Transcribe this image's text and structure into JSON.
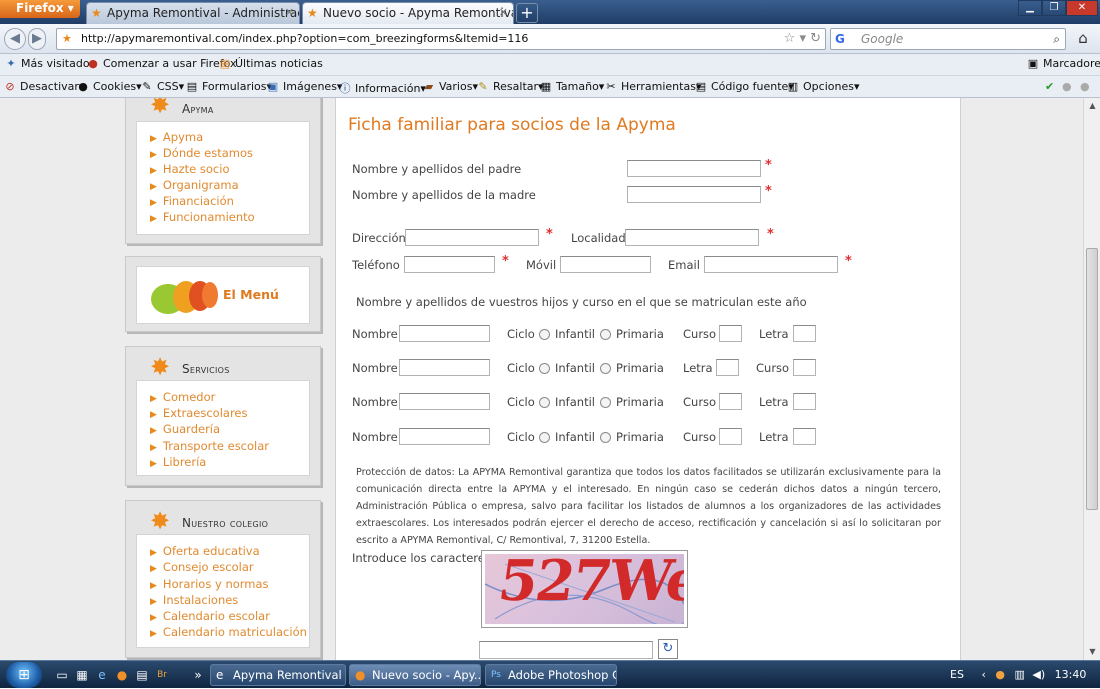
{
  "browser": {
    "menu_label": "Firefox",
    "tabs": [
      {
        "label": "Apyma Remontival - Administración",
        "active": false
      },
      {
        "label": "Nuevo socio - Apyma Remontival",
        "active": true
      }
    ],
    "url": "http://apymaremontival.com/index.php?option=com_breezingforms&Itemid=116",
    "search_placeholder": "Google",
    "bookmarks": [
      "Más visitados",
      "Comenzar a usar Firefox",
      "Últimas noticias"
    ],
    "bookmarks_right": "Marcadores",
    "webdev_menus": [
      "Desactivar",
      "Cookies",
      "CSS",
      "Formularios",
      "Imágenes",
      "Información",
      "Varios",
      "Resaltar",
      "Tamaño",
      "Herramientas",
      "Código fuente",
      "Opciones"
    ]
  },
  "sidebar": {
    "apyma": {
      "title": "Apyma",
      "items": [
        "Apyma",
        "Dónde estamos",
        "Hazte socio",
        "Organigrama",
        "Financiación",
        "Funcionamiento"
      ]
    },
    "menu_banner": "El Menú",
    "servicios": {
      "title": "Servicios",
      "items": [
        "Comedor",
        "Extraescolares",
        "Guardería",
        "Transporte escolar",
        "Librería"
      ]
    },
    "colegio": {
      "title": "Nuestro colegio",
      "items": [
        "Oferta educativa",
        "Consejo escolar",
        "Horarios y normas",
        "Instalaciones",
        "Calendario escolar",
        "Calendario matriculación"
      ]
    }
  },
  "form": {
    "title": "Ficha familiar para socios de la Apyma",
    "padre_label": "Nombre y apellidos del padre",
    "madre_label": "Nombre y apellidos de la madre",
    "direccion_label": "Dirección",
    "localidad_label": "Localidad",
    "telefono_label": "Teléfono",
    "movil_label": "Móvil",
    "email_label": "Email",
    "required_mark": "*",
    "children_heading": "Nombre y apellidos de vuestros hijos y curso en el que se matriculan este año",
    "children": [
      {
        "nombre": "Nombre",
        "ciclo": "Ciclo",
        "opt1": "Infantil",
        "opt2": "Primaria",
        "f1": "Curso",
        "f2": "Letra"
      },
      {
        "nombre": "Nombre",
        "ciclo": "Ciclo",
        "opt1": "Infantil",
        "opt2": "Primaria",
        "f1": "Letra",
        "f2": "Curso"
      },
      {
        "nombre": "Nombre",
        "ciclo": "Ciclo",
        "opt1": "Infantil",
        "opt2": "Primaria",
        "f1": "Curso",
        "f2": "Letra"
      },
      {
        "nombre": "Nombre",
        "ciclo": "Ciclo",
        "opt1": "Infantil",
        "opt2": "Primaria",
        "f1": "Curso",
        "f2": "Letra"
      }
    ],
    "privacy": "Protección de datos: La APYMA Remontival garantiza que todos los datos facilitados se utilizarán exclusivamente para la comunicación directa entre la APYMA y el interesado. En ningún caso se cederán dichos datos a ningún tercero, Administración Pública o empresa, salvo para facilitar los listados de alumnos a los organizadores de las actividades extraescolares. Los interesados podrán ejercer el derecho de acceso, rectificación y cancelación si así lo solicitaran por escrito a APYMA Remontival, C/ Remontival, 7, 31200 Estella.",
    "captcha_label": "Introduce los caracteres",
    "captcha_text": "527We"
  },
  "taskbar": {
    "tasks": [
      "Apyma Remontival ...",
      "Nuevo socio - Apy...",
      "Adobe Photoshop C..."
    ],
    "lang": "ES",
    "time": "13:40"
  },
  "colors": {
    "accent": "#e8891c",
    "title": "#e07a20",
    "required": "#e23030"
  }
}
